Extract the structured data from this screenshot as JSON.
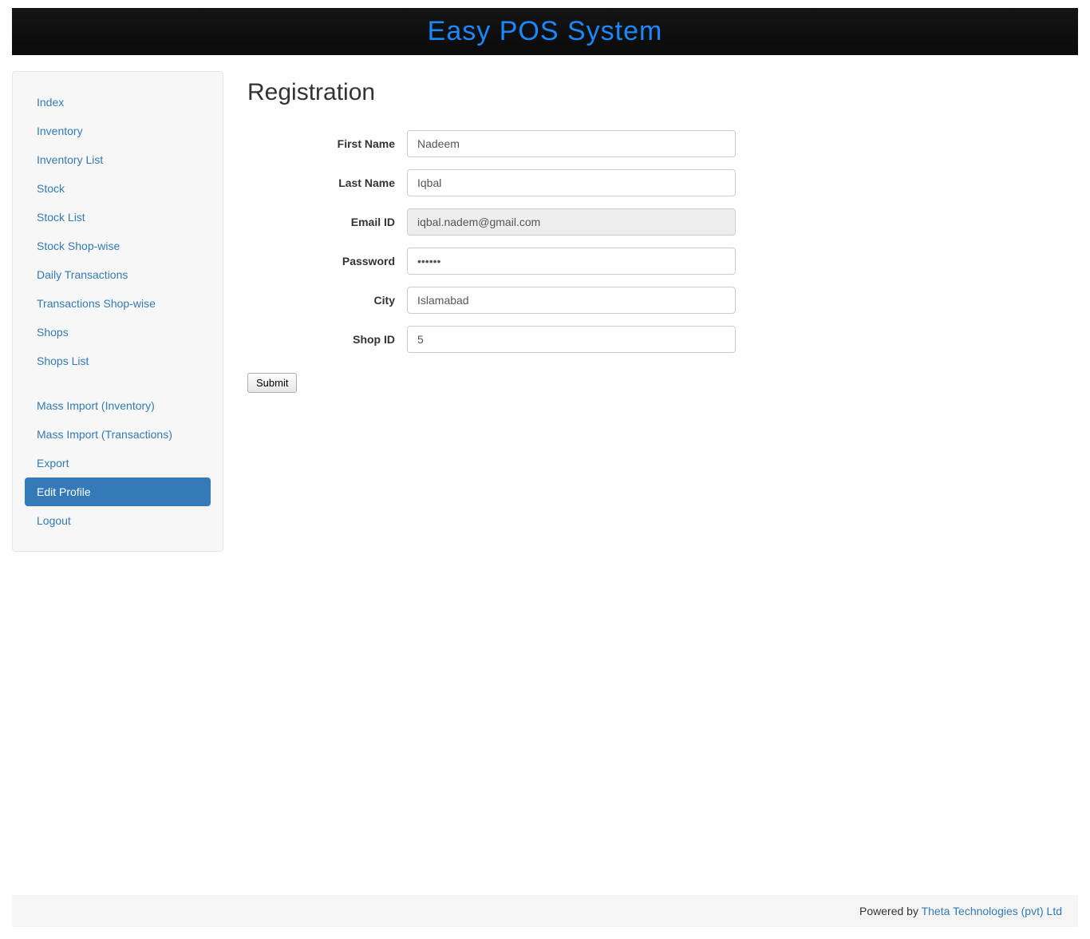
{
  "header": {
    "title": "Easy POS System"
  },
  "sidebar": {
    "items": [
      {
        "label": "Index",
        "key": "index"
      },
      {
        "label": "Inventory",
        "key": "inventory"
      },
      {
        "label": "Inventory List",
        "key": "inventory-list"
      },
      {
        "label": "Stock",
        "key": "stock"
      },
      {
        "label": "Stock List",
        "key": "stock-list"
      },
      {
        "label": "Stock Shop-wise",
        "key": "stock-shop-wise"
      },
      {
        "label": "Daily Transactions",
        "key": "daily-transactions"
      },
      {
        "label": "Transactions Shop-wise",
        "key": "transactions-shop-wise"
      },
      {
        "label": "Shops",
        "key": "shops"
      },
      {
        "label": "Shops List",
        "key": "shops-list"
      }
    ],
    "items2": [
      {
        "label": "Mass Import (Inventory)",
        "key": "mass-import-inventory"
      },
      {
        "label": "Mass Import (Transactions)",
        "key": "mass-import-transactions"
      },
      {
        "label": "Export",
        "key": "export"
      },
      {
        "label": "Edit Profile",
        "key": "edit-profile",
        "active": true
      },
      {
        "label": "Logout",
        "key": "logout"
      }
    ]
  },
  "main": {
    "title": "Registration",
    "form": {
      "first_name": {
        "label": "First Name",
        "value": "Nadeem"
      },
      "last_name": {
        "label": "Last Name",
        "value": "Iqbal"
      },
      "email": {
        "label": "Email ID",
        "value": "iqbal.nadem@gmail.com"
      },
      "password": {
        "label": "Password",
        "value": "••••••"
      },
      "city": {
        "label": "City",
        "value": "Islamabad"
      },
      "shop_id": {
        "label": "Shop ID",
        "value": "5"
      },
      "submit": "Submit"
    }
  },
  "footer": {
    "powered_by": "Powered by ",
    "link_text": "Theta Technologies (pvt) Ltd"
  }
}
